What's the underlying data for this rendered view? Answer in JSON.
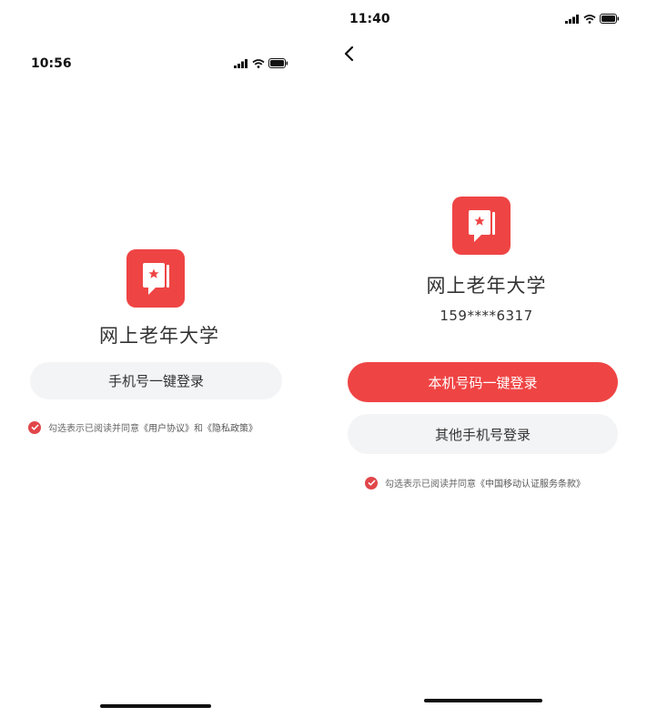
{
  "left_screen": {
    "status": {
      "time": "10:56"
    },
    "app_name": "网上老年大学",
    "one_click_login_label": "手机号一键登录",
    "agreement": {
      "prefix": "勾选表示已阅读并同意",
      "link_user_agreement": "《用户协议》",
      "conjunction": "和",
      "link_privacy_policy": "《隐私政策》"
    }
  },
  "right_screen": {
    "status": {
      "time": "11:40"
    },
    "app_name": "网上老年大学",
    "phone_masked": "159****6317",
    "primary_login_label": "本机号码一键登录",
    "other_phone_login_label": "其他手机号登录",
    "agreement": {
      "prefix": "勾选表示已阅读并同意",
      "link_cmcc_terms": "《中国移动认证服务条款》"
    }
  },
  "colors": {
    "brand_red": "#ef4444",
    "button_gray": "#f3f4f6"
  },
  "icons": [
    "signal-icon",
    "wifi-icon",
    "battery-icon",
    "back-arrow-icon",
    "book-logo-icon",
    "check-circle-icon"
  ]
}
